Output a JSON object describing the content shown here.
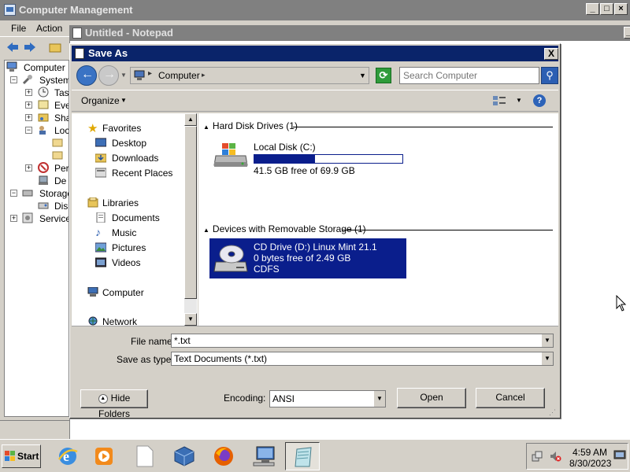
{
  "computer_management": {
    "title": "Computer Management",
    "menu": [
      "File",
      "Action"
    ],
    "tree": {
      "root": "Computer M",
      "system": "System",
      "task": "Tas",
      "event": "Eve",
      "shared": "Sha",
      "local": "Loc",
      "perf": "Per",
      "device": "De",
      "storage": "Storage",
      "disk": "Dis",
      "services": "Service"
    }
  },
  "notepad": {
    "title": "Untitled - Notepad"
  },
  "save_as": {
    "title": "Save As",
    "close_label": "X",
    "address": {
      "location": "Computer",
      "separator": "▸"
    },
    "search": {
      "placeholder": "Search Computer"
    },
    "command_bar": {
      "organize": "Organize"
    },
    "nav": {
      "favorites": "Favorites",
      "desktop": "Desktop",
      "downloads": "Downloads",
      "recent": "Recent Places",
      "libraries": "Libraries",
      "documents": "Documents",
      "music": "Music",
      "pictures": "Pictures",
      "videos": "Videos",
      "computer": "Computer",
      "network": "Network"
    },
    "groups": {
      "hdd": {
        "header": "Hard Disk Drives (1)"
      },
      "removable": {
        "header": "Devices with Removable Storage (1)"
      }
    },
    "drives": {
      "local": {
        "name": "Local Disk (C:)",
        "free": "41.5 GB free of 69.9 GB",
        "used_fraction": 0.41
      },
      "cd": {
        "name": "CD Drive (D:) Linux Mint 21.1",
        "free": "0 bytes free of 2.49 GB",
        "fs": "CDFS"
      }
    },
    "fields": {
      "file_name_label": "File name:",
      "file_name_value": "*.txt",
      "type_label": "Save as type:",
      "type_value": "Text Documents (*.txt)",
      "encoding_label": "Encoding:",
      "encoding_value": "ANSI"
    },
    "buttons": {
      "hide_folders": "Hide Folders",
      "open": "Open",
      "cancel": "Cancel"
    }
  },
  "taskbar": {
    "start": "Start",
    "clock_time": "4:59 AM",
    "clock_date": "8/30/2023"
  },
  "colors": {
    "dialog_title": "#0a246a",
    "selection": "#0a1e8c",
    "progress": "#0a1e8c",
    "face": "#d4d0c8"
  }
}
